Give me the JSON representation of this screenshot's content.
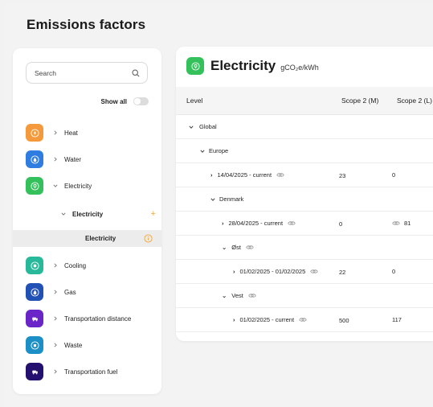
{
  "page": {
    "title": "Emissions factors"
  },
  "sidebar": {
    "search_placeholder": "Search",
    "show_all_label": "Show all",
    "categories": [
      {
        "label": "Heat",
        "color": "#f59a3c",
        "icon": "heat-icon"
      },
      {
        "label": "Water",
        "color": "#2f7de1",
        "icon": "water-drop-icon"
      },
      {
        "label": "Electricity",
        "color": "#34c15b",
        "icon": "lightbulb-icon"
      },
      {
        "label": "Cooling",
        "color": "#27b99a",
        "icon": "cooling-icon"
      },
      {
        "label": "Gas",
        "color": "#2251b5",
        "icon": "gas-flame-icon"
      },
      {
        "label": "Transportation distance",
        "color": "#6a25c9",
        "icon": "transport-icon"
      },
      {
        "label": "Waste",
        "color": "#1b8fc6",
        "icon": "waste-icon"
      },
      {
        "label": "Transportation fuel",
        "color": "#24106e",
        "icon": "transport-fuel-icon"
      }
    ],
    "sub_item": {
      "label": "Electricity"
    },
    "selected_item": {
      "label": "Electricity"
    }
  },
  "panel": {
    "title": "Electricity",
    "unit": "gCO₂e/kWh",
    "columns": [
      "Level",
      "Scope 2 (M)",
      "Scope 2 (L)"
    ],
    "rows": [
      {
        "label": "Global",
        "scope2m": "",
        "scope2l": ""
      },
      {
        "label": "Europe",
        "scope2m": "",
        "scope2l": ""
      },
      {
        "label": "14/04/2025 - current",
        "scope2m": "23",
        "scope2l": "0"
      },
      {
        "label": "Denmark",
        "scope2m": "",
        "scope2l": ""
      },
      {
        "label": "28/04/2025 - current",
        "scope2m": "0",
        "scope2l": "81"
      },
      {
        "label": "Øst",
        "scope2m": "",
        "scope2l": ""
      },
      {
        "label": "01/02/2025 - 01/02/2025",
        "scope2m": "22",
        "scope2l": "0"
      },
      {
        "label": "Vest",
        "scope2m": "",
        "scope2l": ""
      },
      {
        "label": "01/02/2025 - current",
        "scope2m": "500",
        "scope2l": "117"
      }
    ]
  }
}
